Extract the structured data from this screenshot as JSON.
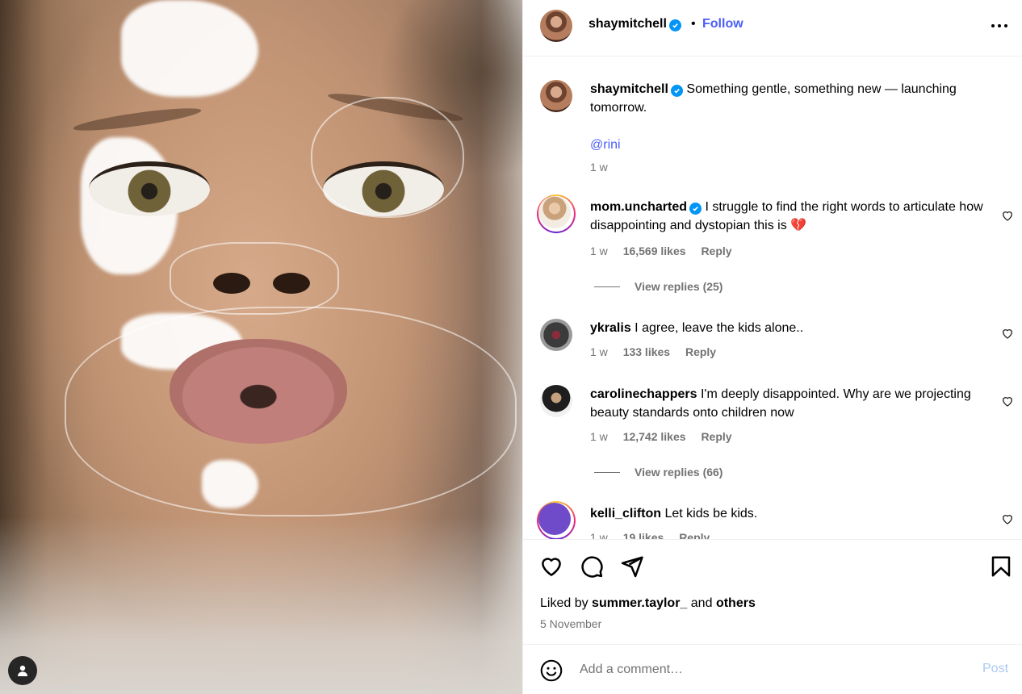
{
  "post": {
    "author": "shaymitchell",
    "follow_label": "Follow",
    "separator": "•"
  },
  "caption": {
    "author": "shaymitchell",
    "text": "Something gentle, something new — launching tomorrow.",
    "mention": "@rini",
    "time": "1 w"
  },
  "comments": [
    {
      "author": "mom.uncharted",
      "text": "I struggle to find the right words to articulate how disappointing and dystopian this is 💔",
      "time": "1 w",
      "likes": "16,569 likes",
      "reply_label": "Reply",
      "view_replies": "View replies (25)"
    },
    {
      "author": "ykralis",
      "text": "I agree, leave the kids alone..",
      "time": "1 w",
      "likes": "133 likes",
      "reply_label": "Reply"
    },
    {
      "author": "carolinechappers",
      "text": "I'm deeply disappointed. Why are we projecting beauty standards onto children now",
      "time": "1 w",
      "likes": "12,742 likes",
      "reply_label": "Reply",
      "view_replies": "View replies (66)"
    },
    {
      "author": "kelli_clifton",
      "text": "Let kids be kids.",
      "time": "1 w",
      "likes": "19 likes",
      "reply_label": "Reply"
    }
  ],
  "likes": {
    "prefix": "Liked by",
    "user": "summer.taylor_",
    "joiner": "and",
    "others": "others"
  },
  "date": "5 November",
  "composer": {
    "placeholder": "Add a comment…",
    "post_label": "Post"
  },
  "colors": {
    "link": "#4a5df9",
    "verified": "#0095f6",
    "muted": "#737373",
    "post_disabled": "#a9c9f0"
  },
  "icons": {
    "like": "heart-icon",
    "comment": "comment-icon",
    "share": "paper-plane-icon",
    "save": "bookmark-icon",
    "more": "more-horizontal-icon",
    "emoji": "emoji-icon",
    "verified": "verified-badge-icon",
    "tagged_user": "user-icon"
  }
}
